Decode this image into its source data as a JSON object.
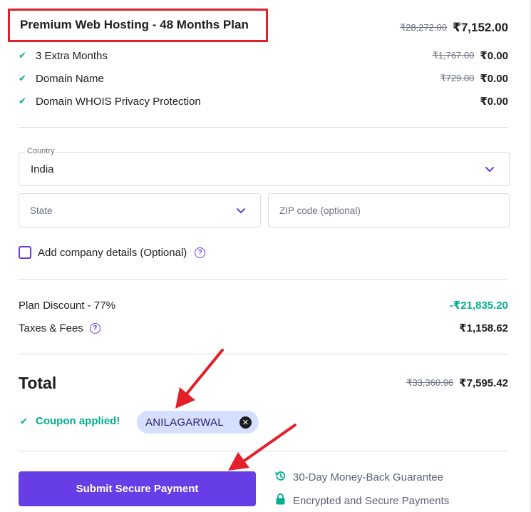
{
  "plan": {
    "title": "Premium Web Hosting - 48 Months Plan",
    "original_price": "₹28,272.00",
    "price": "₹7,152.00"
  },
  "features": [
    {
      "label": "3 Extra Months",
      "original_price": "₹1,767.00",
      "price": "₹0.00"
    },
    {
      "label": "Domain Name",
      "original_price": "₹729.00",
      "price": "₹0.00"
    },
    {
      "label": "Domain WHOIS Privacy Protection",
      "original_price": "",
      "price": "₹0.00"
    }
  ],
  "address": {
    "country_label": "Country",
    "country_value": "India",
    "state_placeholder": "State",
    "zip_placeholder": "ZIP code (optional)",
    "company_label": "Add company details (Optional)"
  },
  "summary": {
    "discount_label": "Plan Discount - 77%",
    "discount_value": "-₹21,835.20",
    "taxes_label": "Taxes & Fees",
    "taxes_value": "₹1,158.62",
    "total_label": "Total",
    "total_original": "₹33,360.96",
    "total_value": "₹7,595.42"
  },
  "coupon": {
    "status": "Coupon applied!",
    "code": "ANILAGARWAL"
  },
  "payment": {
    "submit_label": "Submit Secure Payment",
    "guarantee_1": "30-Day Money-Back Guarantee",
    "guarantee_2": "Encrypted and Secure Payments"
  },
  "colors": {
    "brand": "#673de6",
    "success": "#00b090",
    "highlight_border": "#e3202a",
    "annotation_arrow": "#e3202a"
  }
}
